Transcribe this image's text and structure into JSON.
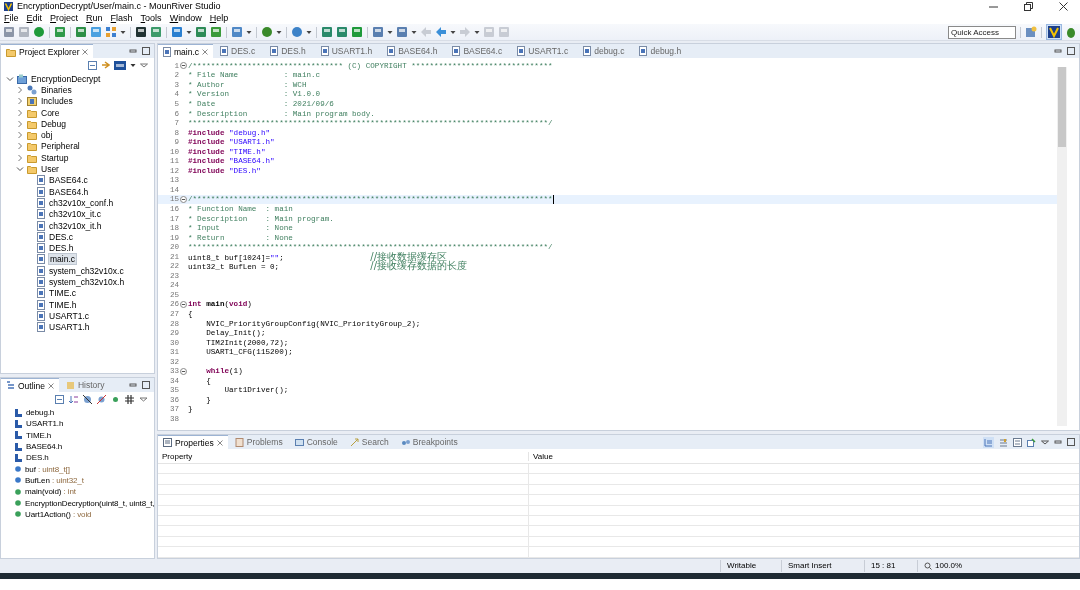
{
  "window": {
    "title": "EncryptionDecrypt/User/main.c - MounRiver Studio"
  },
  "menu": [
    "File",
    "Edit",
    "Project",
    "Run",
    "Flash",
    "Tools",
    "Window",
    "Help"
  ],
  "quick_access": {
    "placeholder": "Quick Access"
  },
  "project_explorer": {
    "title": "Project Explorer",
    "items": [
      {
        "label": "EncryptionDecrypt",
        "kind": "project",
        "expanded": true,
        "selected": false,
        "children": [
          {
            "label": "Binaries",
            "kind": "binaries",
            "expanded": false,
            "selected": false
          },
          {
            "label": "Includes",
            "kind": "includes",
            "expanded": false,
            "selected": false
          },
          {
            "label": "Core",
            "kind": "folder",
            "expanded": false,
            "selected": false
          },
          {
            "label": "Debug",
            "kind": "folder",
            "expanded": false,
            "selected": false
          },
          {
            "label": "obj",
            "kind": "folder",
            "expanded": false,
            "selected": false
          },
          {
            "label": "Peripheral",
            "kind": "folder",
            "expanded": false,
            "selected": false
          },
          {
            "label": "Startup",
            "kind": "folder",
            "expanded": false,
            "selected": false
          },
          {
            "label": "User",
            "kind": "folder",
            "expanded": true,
            "selected": false,
            "children": [
              {
                "label": "BASE64.c",
                "kind": "file",
                "selected": false
              },
              {
                "label": "BASE64.h",
                "kind": "file",
                "selected": false
              },
              {
                "label": "ch32v10x_conf.h",
                "kind": "file",
                "selected": false
              },
              {
                "label": "ch32v10x_it.c",
                "kind": "file",
                "selected": false
              },
              {
                "label": "ch32v10x_it.h",
                "kind": "file",
                "selected": false
              },
              {
                "label": "DES.c",
                "kind": "file",
                "selected": false
              },
              {
                "label": "DES.h",
                "kind": "file",
                "selected": false
              },
              {
                "label": "main.c",
                "kind": "file",
                "selected": true
              },
              {
                "label": "system_ch32v10x.c",
                "kind": "file",
                "selected": false
              },
              {
                "label": "system_ch32v10x.h",
                "kind": "file",
                "selected": false
              },
              {
                "label": "TIME.c",
                "kind": "file",
                "selected": false
              },
              {
                "label": "TIME.h",
                "kind": "file",
                "selected": false
              },
              {
                "label": "USART1.c",
                "kind": "file",
                "selected": false
              },
              {
                "label": "USART1.h",
                "kind": "file",
                "selected": false
              }
            ]
          }
        ]
      }
    ]
  },
  "outline_tabs": [
    {
      "label": "Outline",
      "selected": true
    },
    {
      "label": "History",
      "selected": false
    }
  ],
  "outline": [
    {
      "label": "debug.h",
      "kind": "include"
    },
    {
      "label": "USART1.h",
      "kind": "include"
    },
    {
      "label": "TIME.h",
      "kind": "include"
    },
    {
      "label": "BASE64.h",
      "kind": "include"
    },
    {
      "label": "DES.h",
      "kind": "include"
    },
    {
      "label": "buf",
      "type": ": uint8_t[]",
      "kind": "variable"
    },
    {
      "label": "BufLen",
      "type": ": uint32_t",
      "kind": "variable"
    },
    {
      "label": "main(void)",
      "type": ": int",
      "kind": "function"
    },
    {
      "label": "EncryptionDecryption(uint8_t, uint8_t,",
      "kind": "function"
    },
    {
      "label": "Uart1Action()",
      "type": ": void",
      "kind": "function"
    }
  ],
  "editor_tabs": [
    {
      "label": "main.c",
      "selected": true
    },
    {
      "label": "DES.c",
      "selected": false
    },
    {
      "label": "DES.h",
      "selected": false
    },
    {
      "label": "USART1.h",
      "selected": false
    },
    {
      "label": "BASE64.h",
      "selected": false
    },
    {
      "label": "BASE64.c",
      "selected": false
    },
    {
      "label": "USART1.c",
      "selected": false
    },
    {
      "label": "debug.c",
      "selected": false
    },
    {
      "label": "debug.h",
      "selected": false
    }
  ],
  "code": [
    {
      "number": "1",
      "fold": true,
      "current": false,
      "segments": [
        {
          "kind": "comment",
          "text": "/********************************* (C) COPYRIGHT *******************************"
        }
      ]
    },
    {
      "number": "2",
      "fold": false,
      "current": false,
      "segments": [
        {
          "kind": "comment",
          "text": "* File Name          : main.c"
        }
      ]
    },
    {
      "number": "3",
      "fold": false,
      "current": false,
      "segments": [
        {
          "kind": "comment",
          "text": "* Author             : WCH"
        }
      ]
    },
    {
      "number": "4",
      "fold": false,
      "current": false,
      "segments": [
        {
          "kind": "comment",
          "text": "* Version            : V1.0.0"
        }
      ]
    },
    {
      "number": "5",
      "fold": false,
      "current": false,
      "segments": [
        {
          "kind": "comment",
          "text": "* Date               : 2021/09/6"
        }
      ]
    },
    {
      "number": "6",
      "fold": false,
      "current": false,
      "segments": [
        {
          "kind": "comment",
          "text": "* Description        : Main program body."
        }
      ]
    },
    {
      "number": "7",
      "fold": false,
      "current": false,
      "segments": [
        {
          "kind": "comment",
          "text": "*******************************************************************************/"
        }
      ]
    },
    {
      "number": "8",
      "fold": false,
      "current": false,
      "segments": [
        {
          "kind": "directive",
          "text": "#include "
        },
        {
          "kind": "string",
          "text": "\"debug.h\""
        }
      ]
    },
    {
      "number": "9",
      "fold": false,
      "current": false,
      "segments": [
        {
          "kind": "directive",
          "text": "#include "
        },
        {
          "kind": "string",
          "text": "\"USART1.h\""
        }
      ]
    },
    {
      "number": "10",
      "fold": false,
      "current": false,
      "segments": [
        {
          "kind": "directive",
          "text": "#include "
        },
        {
          "kind": "string",
          "text": "\"TIME.h\""
        }
      ]
    },
    {
      "number": "11",
      "fold": false,
      "current": false,
      "segments": [
        {
          "kind": "directive",
          "text": "#include "
        },
        {
          "kind": "string",
          "text": "\"BASE64.h\""
        }
      ]
    },
    {
      "number": "12",
      "fold": false,
      "current": false,
      "segments": [
        {
          "kind": "directive",
          "text": "#include "
        },
        {
          "kind": "string",
          "text": "\"DES.h\""
        }
      ]
    },
    {
      "number": "13",
      "fold": false,
      "current": false
    },
    {
      "number": "14",
      "fold": false,
      "current": false
    },
    {
      "number": "15",
      "fold": true,
      "current": true,
      "segments": [
        {
          "kind": "comment",
          "text": "/*******************************************************************************"
        }
      ]
    },
    {
      "number": "16",
      "fold": false,
      "current": false,
      "segments": [
        {
          "kind": "comment",
          "text": "* Function Name  : main"
        }
      ]
    },
    {
      "number": "17",
      "fold": false,
      "current": false,
      "segments": [
        {
          "kind": "comment",
          "text": "* Description    : Main program."
        }
      ]
    },
    {
      "number": "18",
      "fold": false,
      "current": false,
      "segments": [
        {
          "kind": "comment",
          "text": "* Input          : None"
        }
      ]
    },
    {
      "number": "19",
      "fold": false,
      "current": false,
      "segments": [
        {
          "kind": "comment",
          "text": "* Return         : None"
        }
      ]
    },
    {
      "number": "20",
      "fold": false,
      "current": false,
      "segments": [
        {
          "kind": "comment",
          "text": "*******************************************************************************/"
        }
      ]
    },
    {
      "number": "21",
      "fold": false,
      "current": false,
      "segments": [
        {
          "kind": "plain",
          "text": "uint8_t buf[1024]="
        },
        {
          "kind": "string",
          "text": "\"\""
        },
        {
          "kind": "plain",
          "text": ";                   "
        },
        {
          "kind": "trailing",
          "text": "//接收数据缓存区"
        }
      ]
    },
    {
      "number": "22",
      "fold": false,
      "current": false,
      "segments": [
        {
          "kind": "plain",
          "text": "uint32_t BufLen = 0;                    "
        },
        {
          "kind": "trailing",
          "text": "//接收缓存数据的长度"
        }
      ]
    },
    {
      "number": "23",
      "fold": false,
      "current": false
    },
    {
      "number": "24",
      "fold": false,
      "current": false
    },
    {
      "number": "25",
      "fold": false,
      "current": false
    },
    {
      "number": "26",
      "fold": true,
      "current": false,
      "segments": [
        {
          "kind": "keyword",
          "text": "int"
        },
        {
          "kind": "bold",
          "text": " main"
        },
        {
          "kind": "plain",
          "text": "("
        },
        {
          "kind": "keyword",
          "text": "void"
        },
        {
          "kind": "plain",
          "text": ")"
        }
      ]
    },
    {
      "number": "27",
      "fold": false,
      "current": false,
      "segments": [
        {
          "kind": "plain",
          "text": "{"
        }
      ]
    },
    {
      "number": "28",
      "fold": false,
      "current": false,
      "segments": [
        {
          "kind": "plain",
          "text": "    NVIC_PriorityGroupConfig(NVIC_PriorityGroup_2);"
        }
      ]
    },
    {
      "number": "29",
      "fold": false,
      "current": false,
      "segments": [
        {
          "kind": "plain",
          "text": "    Delay_Init();"
        }
      ]
    },
    {
      "number": "30",
      "fold": false,
      "current": false,
      "segments": [
        {
          "kind": "plain",
          "text": "    TIM2Init(2000,72);"
        }
      ]
    },
    {
      "number": "31",
      "fold": false,
      "current": false,
      "segments": [
        {
          "kind": "plain",
          "text": "    USART1_CFG(115200);"
        }
      ]
    },
    {
      "number": "32",
      "fold": false,
      "current": false
    },
    {
      "number": "33",
      "fold": true,
      "current": false,
      "segments": [
        {
          "kind": "keyword",
          "text": "    while"
        },
        {
          "kind": "plain",
          "text": "(1)"
        }
      ]
    },
    {
      "number": "34",
      "fold": false,
      "current": false,
      "segments": [
        {
          "kind": "plain",
          "text": "    {"
        }
      ]
    },
    {
      "number": "35",
      "fold": false,
      "current": false,
      "segments": [
        {
          "kind": "plain",
          "text": "        Uart1Driver();"
        }
      ]
    },
    {
      "number": "36",
      "fold": false,
      "current": false,
      "segments": [
        {
          "kind": "plain",
          "text": "    }"
        }
      ]
    },
    {
      "number": "37",
      "fold": false,
      "current": false,
      "segments": [
        {
          "kind": "plain",
          "text": "}"
        }
      ]
    },
    {
      "number": "38",
      "fold": false,
      "current": false
    }
  ],
  "bottom_tabs": [
    {
      "label": "Properties",
      "selected": true
    },
    {
      "label": "Problems",
      "selected": false
    },
    {
      "label": "Console",
      "selected": false
    },
    {
      "label": "Search",
      "selected": false
    },
    {
      "label": "Breakpoints",
      "selected": false
    }
  ],
  "properties_table": {
    "columns": [
      "Property",
      "Value"
    ]
  },
  "status_bar": [
    "Writable",
    "Smart Insert",
    "15 : 81",
    "100.0%"
  ]
}
